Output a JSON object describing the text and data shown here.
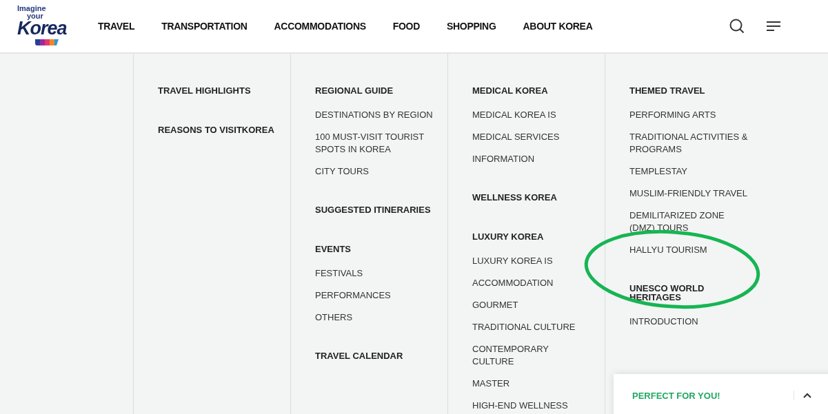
{
  "logo": {
    "line_1": "Imagine",
    "line_2": "your",
    "line_3": "Korea"
  },
  "nav": [
    {
      "label": "TRAVEL"
    },
    {
      "label": "TRANSPORTATION"
    },
    {
      "label": "ACCOMMODATIONS"
    },
    {
      "label": "FOOD"
    },
    {
      "label": "SHOPPING"
    },
    {
      "label": "ABOUT KOREA"
    }
  ],
  "menu_columns": [
    {
      "items": [
        {
          "kind": "heading",
          "label": "TRAVEL HIGHLIGHTS"
        },
        {
          "kind": "heading",
          "label": "REASONS TO VISITKOREA"
        }
      ]
    },
    {
      "items": [
        {
          "kind": "heading",
          "label": "REGIONAL GUIDE"
        },
        {
          "kind": "link",
          "label": "DESTINATIONS BY REGION"
        },
        {
          "kind": "link",
          "label": "100 MUST-VISIT TOURIST SPOTS IN KOREA"
        },
        {
          "kind": "link",
          "label": "CITY TOURS"
        },
        {
          "kind": "heading",
          "label": "SUGGESTED ITINERARIES"
        },
        {
          "kind": "heading",
          "label": "EVENTS"
        },
        {
          "kind": "link",
          "label": "FESTIVALS"
        },
        {
          "kind": "link",
          "label": "PERFORMANCES"
        },
        {
          "kind": "link",
          "label": "OTHERS"
        },
        {
          "kind": "heading",
          "label": "TRAVEL CALENDAR"
        }
      ]
    },
    {
      "items": [
        {
          "kind": "heading",
          "label": "MEDICAL KOREA"
        },
        {
          "kind": "link",
          "label": "MEDICAL KOREA IS"
        },
        {
          "kind": "link",
          "label": "MEDICAL SERVICES"
        },
        {
          "kind": "link",
          "label": "INFORMATION"
        },
        {
          "kind": "heading",
          "label": "WELLNESS KOREA"
        },
        {
          "kind": "heading",
          "label": "LUXURY KOREA"
        },
        {
          "kind": "link",
          "label": "LUXURY KOREA IS"
        },
        {
          "kind": "link",
          "label": "ACCOMMODATION"
        },
        {
          "kind": "link",
          "label": "GOURMET"
        },
        {
          "kind": "link",
          "label": "TRADITIONAL CULTURE"
        },
        {
          "kind": "link",
          "label": "CONTEMPORARY CULTURE"
        },
        {
          "kind": "link",
          "label": "MASTER"
        },
        {
          "kind": "link",
          "label": "HIGH-END WELLNESS"
        }
      ]
    },
    {
      "items": [
        {
          "kind": "heading",
          "label": "THEMED TRAVEL"
        },
        {
          "kind": "link",
          "label": "PERFORMING ARTS"
        },
        {
          "kind": "link",
          "label": "TRADITIONAL ACTIVITIES & PROGRAMS"
        },
        {
          "kind": "link",
          "label": "TEMPLESTAY"
        },
        {
          "kind": "link",
          "label": "MUSLIM-FRIENDLY TRAVEL"
        },
        {
          "kind": "link",
          "label": "DEMILITARIZED ZONE (DMZ) TOURS"
        },
        {
          "kind": "link",
          "label": "HALLYU TOURISM"
        },
        {
          "kind": "heading",
          "label": "UNESCO WORLD HERITAGES"
        },
        {
          "kind": "link",
          "label": "INTRODUCTION"
        }
      ]
    }
  ],
  "popup": {
    "title": "PERFECT FOR YOU!",
    "expanded": false
  }
}
